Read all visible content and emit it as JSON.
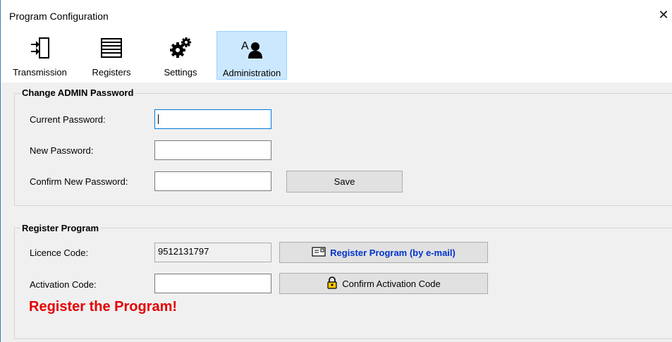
{
  "window": {
    "title": "Program Configuration",
    "close_glyph": "✕"
  },
  "toolbar": {
    "items": [
      {
        "label": "Transmission",
        "icon": "transmission-icon"
      },
      {
        "label": "Registers",
        "icon": "registers-icon"
      },
      {
        "label": "Settings",
        "icon": "gears-icon"
      },
      {
        "label": "Administration",
        "icon": "administration-icon",
        "active": true
      }
    ]
  },
  "admin_password": {
    "title": "Change ADMIN Password",
    "current_label": "Current Password:",
    "current_value": "",
    "new_label": "New Password:",
    "new_value": "",
    "confirm_label": "Confirm New Password:",
    "confirm_value": "",
    "save_label": "Save"
  },
  "register": {
    "title": "Register Program",
    "licence_label": "Licence Code:",
    "licence_value": "9512131797",
    "register_button": "Register Program (by e-mail)",
    "activation_label": "Activation Code:",
    "activation_value": "",
    "confirm_button": "Confirm Activation Code",
    "warning": "Register the Program!"
  },
  "colors": {
    "accent": "#0078d7",
    "active_tab": "#cce8ff",
    "warning": "#e30000",
    "link_blue": "#0033cc"
  }
}
